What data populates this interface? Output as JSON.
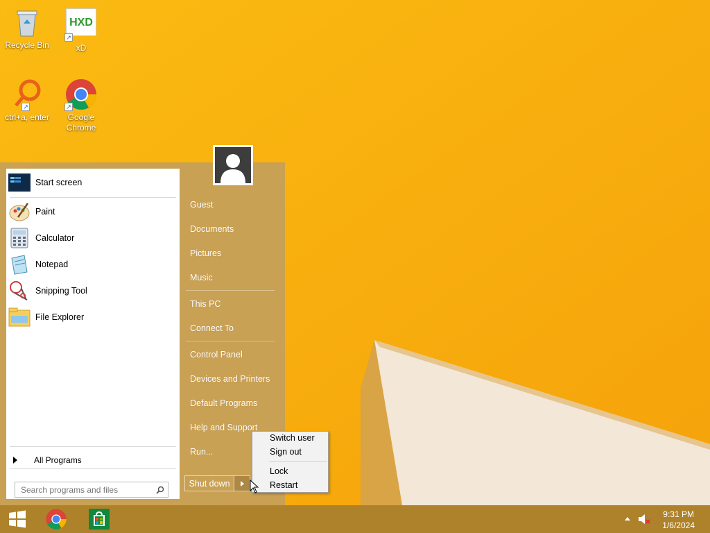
{
  "desktop": {
    "icons": [
      {
        "label": "Recycle Bin",
        "icon": "recycle-bin-icon"
      },
      {
        "label": "xD",
        "icon": "hxd-icon",
        "glyph": "HXD"
      },
      {
        "label": "ctrl+a, enter",
        "icon": "autohotkey-icon"
      },
      {
        "label": "Google Chrome",
        "icon": "chrome-icon"
      }
    ]
  },
  "start_menu": {
    "programs": [
      {
        "label": "Start screen",
        "icon": "start-screen-icon"
      },
      {
        "label": "Paint",
        "icon": "paint-icon"
      },
      {
        "label": "Calculator",
        "icon": "calculator-icon"
      },
      {
        "label": "Notepad",
        "icon": "notepad-icon"
      },
      {
        "label": "Snipping Tool",
        "icon": "snipping-tool-icon"
      },
      {
        "label": "File Explorer",
        "icon": "file-explorer-icon"
      }
    ],
    "all_programs": "All Programs",
    "search_placeholder": "Search programs and files",
    "right_items": {
      "guest": "Guest",
      "documents": "Documents",
      "pictures": "Pictures",
      "music": "Music",
      "this_pc": "This PC",
      "connect_to": "Connect To",
      "control_panel": "Control Panel",
      "devices_and_printers": "Devices and Printers",
      "default_programs": "Default Programs",
      "help_and_support": "Help and Support",
      "run": "Run..."
    },
    "shutdown_label": "Shut down"
  },
  "power_menu": {
    "switch_user": "Switch user",
    "sign_out": "Sign out",
    "lock": "Lock",
    "restart": "Restart"
  },
  "taskbar": {
    "pinned": [
      "start-button",
      "chrome-taskbar-icon",
      "store-taskbar-icon"
    ],
    "time": "9:31 PM",
    "date": "1/6/2024"
  },
  "colors": {
    "wallpaper": "#f9b510",
    "start_menu_bg": "#c4a05a",
    "taskbar_bg": "#aa802d"
  }
}
